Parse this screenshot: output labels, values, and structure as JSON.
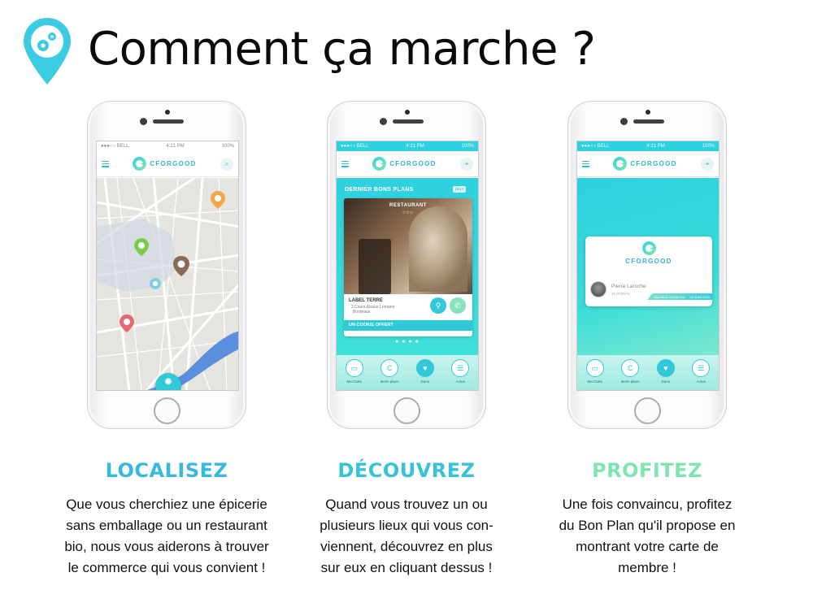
{
  "page": {
    "title": "Comment ça marche ?"
  },
  "colors": {
    "teal": "#2fc9da",
    "heading_localisez": "#36b9dd",
    "heading_decouvrez": "#37c3d7",
    "heading_profitez": "#7fe5b0"
  },
  "icons": {
    "logo": "map-pin-gears-icon"
  },
  "status_bar": {
    "carrier": "●●●○○ BELL",
    "time": "4:21 PM",
    "battery": "100%"
  },
  "brand": {
    "name": "CFORGOOD"
  },
  "deals_screen": {
    "section_title": "DERNIER BONS PLANS",
    "plus_label": "plus",
    "card_category": "RESTAURANT",
    "card_dots": "○○○",
    "place_name": "LABEL TERRE",
    "address_line1": "2 Cours Alsace Lorraine",
    "address_line2": "Bordeaux",
    "offer": "UN COOKIE OFFERT",
    "pager": "● ● ● ●"
  },
  "tabbar": {
    "items": [
      {
        "label": "Ma Carte",
        "icon": "card-icon"
      },
      {
        "label": "Bons plans",
        "icon": "cforgood-icon"
      },
      {
        "label": "Dons",
        "icon": "heart-icon"
      },
      {
        "label": "Actus",
        "icon": "news-icon"
      }
    ]
  },
  "member_screen": {
    "member_name": "Pierre Laroche",
    "points": "35 POINTS",
    "validity": "VALABLE JUSQU'AU",
    "date": "23 JUIN 2015"
  },
  "steps": [
    {
      "heading": "LOCALISEZ",
      "lines": [
        "Que vous cherchiez une épicerie",
        "sans emballage ou un restaurant",
        "bio, nous vous aiderons à trouver",
        "le commerce qui vous convient !"
      ]
    },
    {
      "heading": "DÉCOUVREZ",
      "lines": [
        "Quand vous trouvez un ou",
        "plusieurs lieux qui vous con-",
        "viennent, découvrez en plus",
        "sur eux en cliquant dessus !"
      ]
    },
    {
      "heading": "PROFITEZ",
      "lines": [
        "Une fois convaincu, profitez",
        "du Bon Plan qu'il propose en",
        "montrant votre carte de",
        "membre !"
      ]
    }
  ]
}
